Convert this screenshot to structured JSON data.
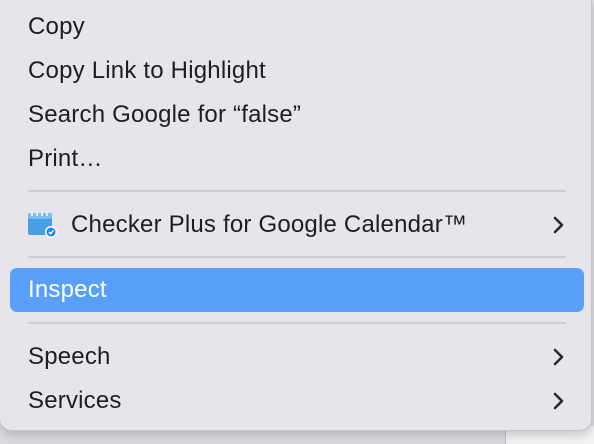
{
  "menu": {
    "items": [
      {
        "label": "Copy"
      },
      {
        "label": "Copy Link to Highlight"
      },
      {
        "label": "Search Google for “false”"
      },
      {
        "label": "Print…"
      },
      {
        "label": "Checker Plus for Google Calendar™",
        "icon": "calendar-extension-icon",
        "submenu": true
      },
      {
        "label": "Inspect",
        "highlighted": true
      },
      {
        "label": "Speech",
        "submenu": true
      },
      {
        "label": "Services",
        "submenu": true
      }
    ]
  },
  "colors": {
    "menu_background": "#e7e4ec",
    "highlight": "#5aa0fb",
    "text": "#1e1e1f",
    "separator": "#cfccd5"
  }
}
